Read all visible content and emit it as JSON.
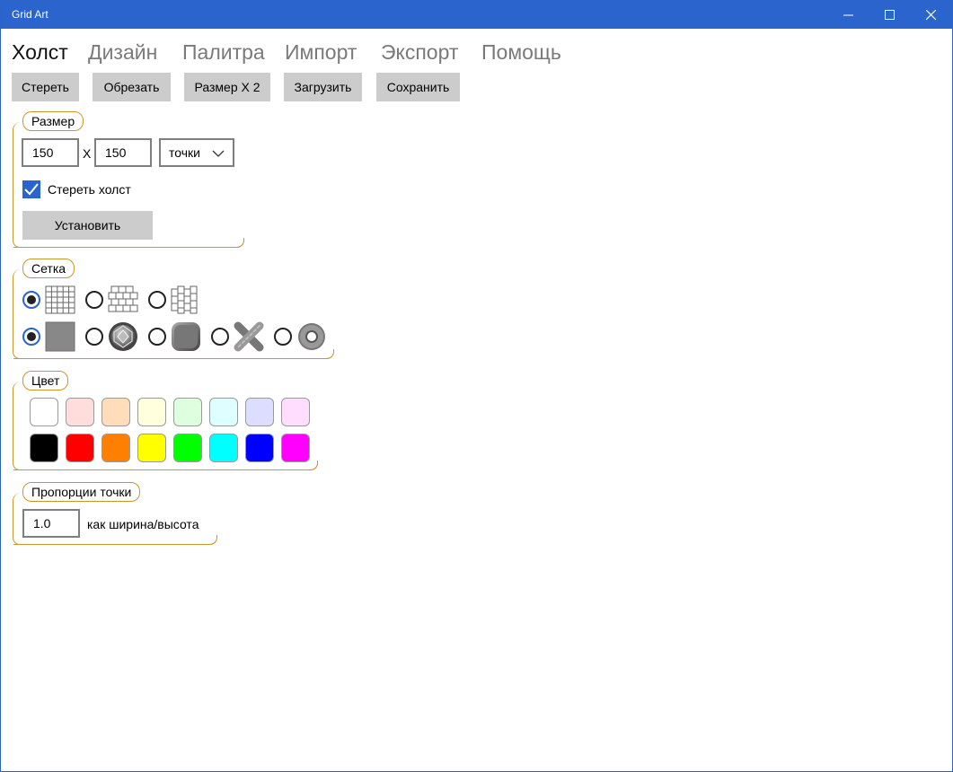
{
  "window": {
    "title": "Grid Art",
    "controls": {
      "minimize": "minimize",
      "maximize": "maximize",
      "close": "close"
    }
  },
  "tabs": [
    "Холст",
    "Дизайн",
    "Палитра",
    "Импорт",
    "Экспорт",
    "Помощь"
  ],
  "active_tab": "Холст",
  "toolbar": {
    "clear": "Стереть",
    "crop": "Обрезать",
    "double": "Размер X 2",
    "load": "Загрузить",
    "save": "Сохранить"
  },
  "size_group": {
    "label": "Размер",
    "width": "150",
    "separator": "X",
    "height": "150",
    "unit": "точки",
    "clear_canvas_checked": true,
    "clear_canvas_label": "Стереть холст",
    "apply_label": "Установить"
  },
  "grid_group": {
    "label": "Сетка",
    "layouts": [
      "square-grid-icon",
      "brick-grid-icon",
      "vertical-brick-grid-icon"
    ],
    "layout_selected": 0,
    "styles": [
      "flat-square-icon",
      "gem-icon",
      "rounded-tile-icon",
      "cross-stitch-icon",
      "ring-bead-icon"
    ],
    "style_selected": 0
  },
  "color_group": {
    "label": "Цвет",
    "light": [
      "#ffffff",
      "#ffdddd",
      "#ffddbb",
      "#ffffdd",
      "#ddffdd",
      "#ddffff",
      "#ddddff",
      "#ffddff"
    ],
    "strong": [
      "#000000",
      "#ff0000",
      "#ff8000",
      "#ffff00",
      "#00ff00",
      "#00ffff",
      "#0000ff",
      "#ff00ff"
    ]
  },
  "ratio_group": {
    "label": "Пропорции точки",
    "value": "1.0",
    "hint": "как ширина/высота"
  }
}
